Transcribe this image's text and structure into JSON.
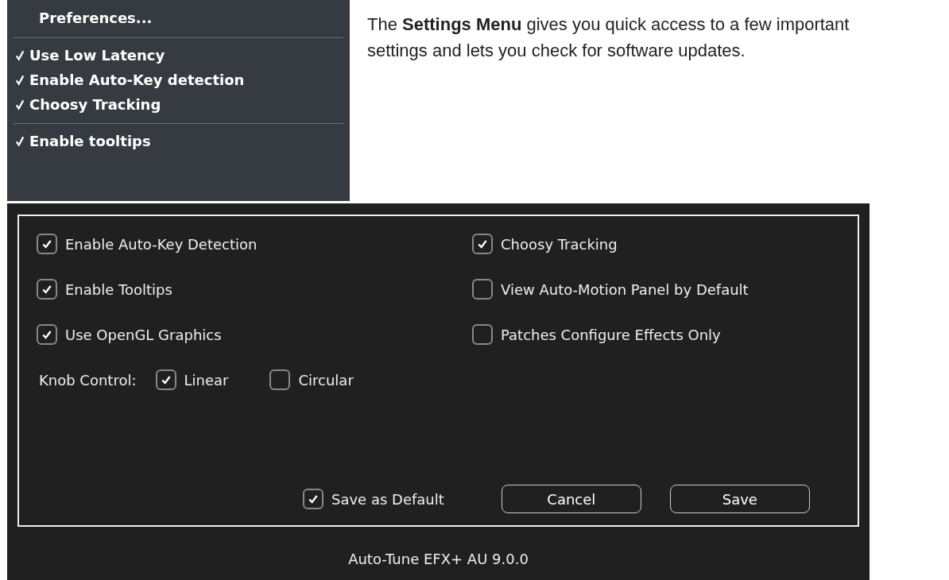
{
  "menu": {
    "title": "Preferences...",
    "groups": [
      [
        {
          "label": "Use Low Latency",
          "checked": true
        },
        {
          "label": "Enable Auto-Key detection",
          "checked": true
        },
        {
          "label": "Choosy Tracking",
          "checked": true
        }
      ],
      [
        {
          "label": "Enable tooltips",
          "checked": true
        }
      ]
    ]
  },
  "description": "The **Settings Menu** gives you quick access to a few important settings and lets you check for software updates.",
  "dialog": {
    "left_options": [
      {
        "label": "Enable Auto-Key Detection",
        "checked": true
      },
      {
        "label": "Enable Tooltips",
        "checked": true
      },
      {
        "label": "Use OpenGL Graphics",
        "checked": true
      }
    ],
    "right_options": [
      {
        "label": "Choosy Tracking",
        "checked": true
      },
      {
        "label": "View Auto-Motion Panel by Default",
        "checked": false
      },
      {
        "label": "Patches Configure Effects Only",
        "checked": false
      }
    ],
    "knob_control": {
      "label": "Knob Control:",
      "options": [
        {
          "label": "Linear",
          "selected": true
        },
        {
          "label": "Circular",
          "selected": false
        }
      ]
    },
    "save_as_default": {
      "label": "Save as Default",
      "checked": true
    },
    "buttons": [
      "Cancel",
      "Save"
    ],
    "footer": "Auto-Tune EFX+ AU 9.0.0"
  }
}
